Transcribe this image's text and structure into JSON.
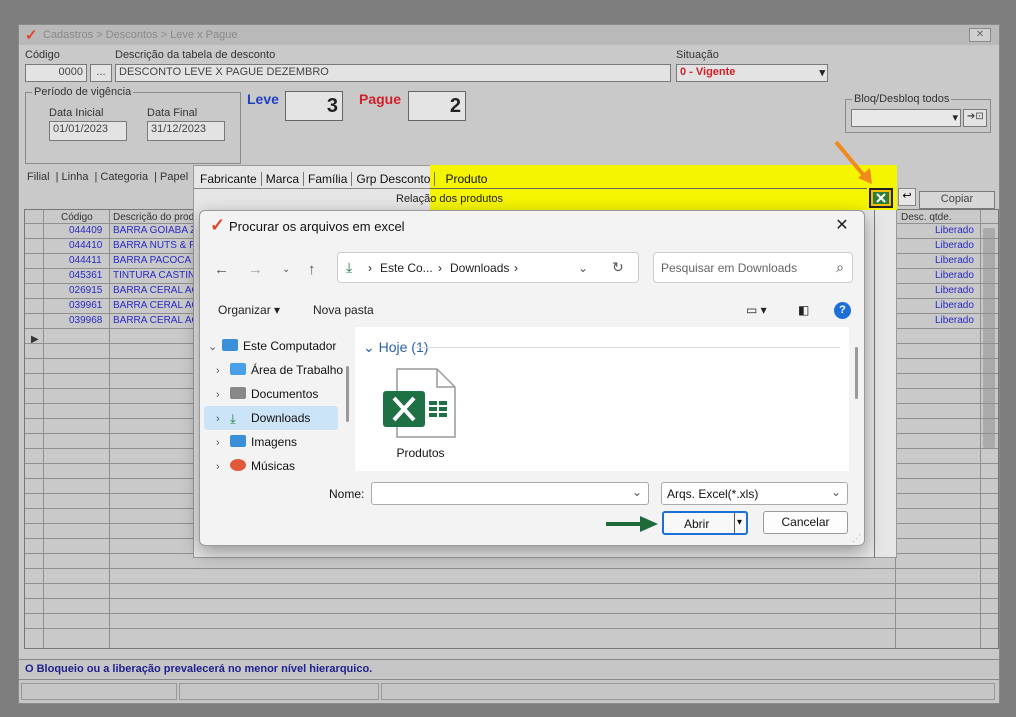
{
  "app": {
    "breadcrumb": "Cadastros > Descontos > Leve x Pague",
    "codigo_label": "Código",
    "codigo_value": "0000",
    "descricao_label": "Descrição da tabela de desconto",
    "descricao_value": "DESCONTO LEVE X PAGUE DEZEMBRO",
    "situacao_label": "Situação",
    "situacao_value": "0 - Vigente",
    "periodo_label": "Período de vigência",
    "data_inicial_label": "Data Inicial",
    "data_inicial_value": "01/01/2023",
    "data_final_label": "Data Final",
    "data_final_value": "31/12/2023",
    "leve_label": "Leve",
    "leve_value": "3",
    "pague_label": "Pague",
    "pague_value": "2",
    "bloq_label": "Bloq/Desbloq todos",
    "tabs": [
      "Filial",
      "Linha",
      "Categoria",
      "Papel"
    ],
    "copiar_label": "Copiar",
    "col_codigo": "Código",
    "col_descricao": "Descrição do prod",
    "col_desc_qtde": "Desc. qtde.",
    "rows": [
      {
        "codigo": "044409",
        "descricao": "BARRA GOIABA Z",
        "status": "Liberado"
      },
      {
        "codigo": "044410",
        "descricao": "BARRA NUTS & F",
        "status": "Liberado"
      },
      {
        "codigo": "044411",
        "descricao": "BARRA PACOCA I",
        "status": "Liberado"
      },
      {
        "codigo": "045361",
        "descricao": "TINTURA CASTIN",
        "status": "Liberado"
      },
      {
        "codigo": "026915",
        "descricao": "BARRA CERAL AC",
        "status": "Liberado"
      },
      {
        "codigo": "039961",
        "descricao": "BARRA CERAL AC",
        "status": "Liberado"
      },
      {
        "codigo": "039968",
        "descricao": "BARRA CERAL AC",
        "status": "Liberado"
      }
    ],
    "status_message": "O Bloqueio ou a liberação prevalecerá no menor nível hierarquico."
  },
  "product_panel": {
    "tabs": [
      "Fabricante",
      "Marca",
      "Família",
      "Grp Desconto",
      "Produto"
    ],
    "relacao_label": "Relação dos produtos"
  },
  "dialog": {
    "title": "Procurar os arquivos em excel",
    "address": {
      "part1": "Este Co...",
      "part2": "Downloads"
    },
    "search_placeholder": "Pesquisar em Downloads",
    "organizar": "Organizar",
    "nova_pasta": "Nova pasta",
    "nav_items": [
      "Este Computador",
      "Área de Trabalho",
      "Documentos",
      "Downloads",
      "Imagens",
      "Músicas"
    ],
    "group_label": "Hoje (1)",
    "file_name": "Produtos",
    "name_label": "Nome:",
    "name_value": "",
    "file_type": "Arqs. Excel(*.xls)",
    "open_label": "Abrir",
    "cancel_label": "Cancelar"
  },
  "colors": {
    "highlight": "#f5f500",
    "arrow_orange": "#f08a1c",
    "arrow_green": "#1e6b3a",
    "excel_green": "#1e7145"
  }
}
